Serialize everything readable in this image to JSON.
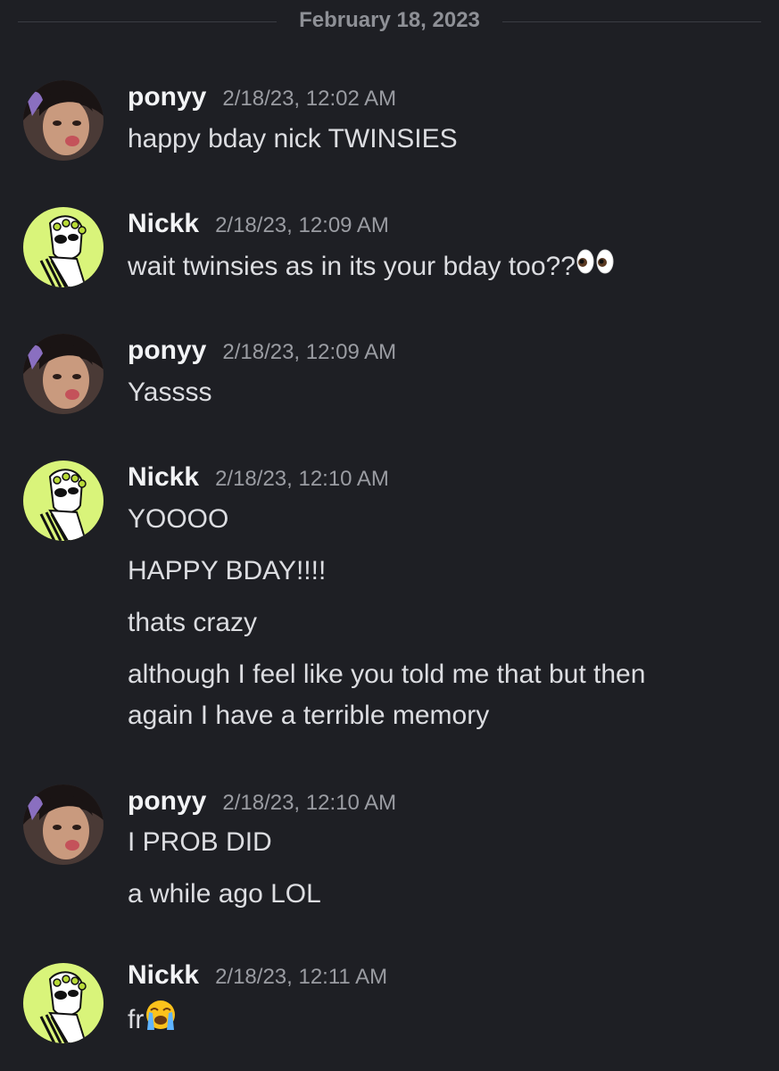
{
  "date_divider": "February 18, 2023",
  "messages": [
    {
      "user": "ponyy",
      "time": "2/18/23, 12:02 AM",
      "lines": [
        "happy bday nick TWINSIES"
      ]
    },
    {
      "user": "Nickk",
      "time": "2/18/23, 12:09 AM",
      "lines": [
        "wait twinsies as in its your bday too??"
      ]
    },
    {
      "user": "ponyy",
      "time": "2/18/23, 12:09 AM",
      "lines": [
        "Yassss"
      ]
    },
    {
      "user": "Nickk",
      "time": "2/18/23, 12:10 AM",
      "lines": [
        "YOOOO",
        "HAPPY BDAY!!!!",
        "thats crazy",
        "although I feel like you told me that but then",
        "again I have a terrible memory"
      ]
    },
    {
      "user": "ponyy",
      "time": "2/18/23, 12:10 AM",
      "lines": [
        "I PROB DID",
        "a while ago LOL"
      ]
    },
    {
      "user": "Nickk",
      "time": "2/18/23, 12:11 AM",
      "lines": [
        "fr"
      ]
    }
  ],
  "icons": {
    "eyes": "eyes-emoji",
    "crying": "loudly-crying-emoji"
  },
  "colors": {
    "background": "#1e1f24",
    "username": "#f2f3f5",
    "timestamp": "#9a9ca2",
    "text": "#dcdde1",
    "nick_avatar_bg": "#d9f47a"
  }
}
